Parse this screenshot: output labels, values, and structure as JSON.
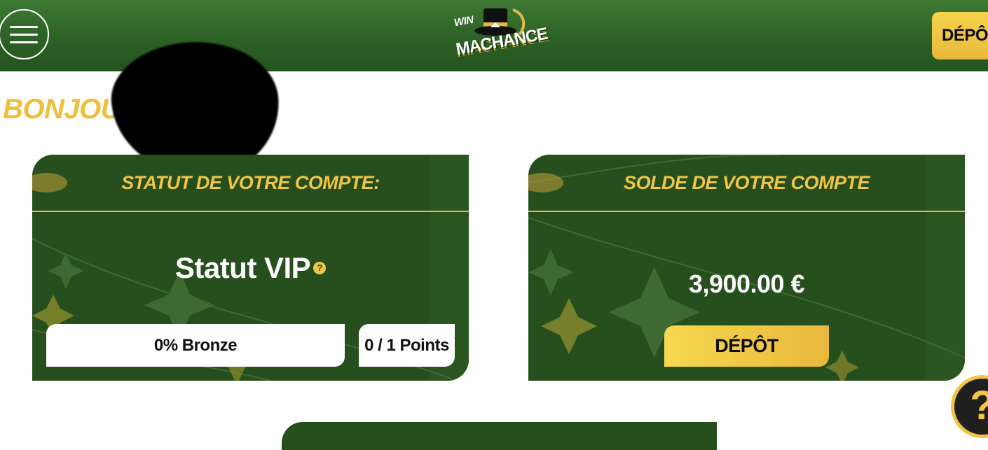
{
  "header": {
    "logo": {
      "top_text": "WIN",
      "main_text": "MACHANCE"
    },
    "deposit_label": "DÉPÔT"
  },
  "greeting": "BONJOUR",
  "status_card": {
    "title": "STATUT DE VOTRE COMPTE:",
    "status_label": "Statut VIP",
    "help_glyph": "?",
    "progress_percent": 0,
    "progress_label": "0% Bronze",
    "points_label": "0 / 1 Points"
  },
  "balance_card": {
    "title": "SOLDE DE VOTRE COMPTE",
    "balance": "3,900.00 €",
    "deposit_label": "DÉPÔT"
  },
  "help_fab_glyph": "?",
  "colors": {
    "header_green": "#2c6125",
    "card_green": "#264f1d",
    "gold": "#f1c545",
    "white": "#ffffff"
  }
}
